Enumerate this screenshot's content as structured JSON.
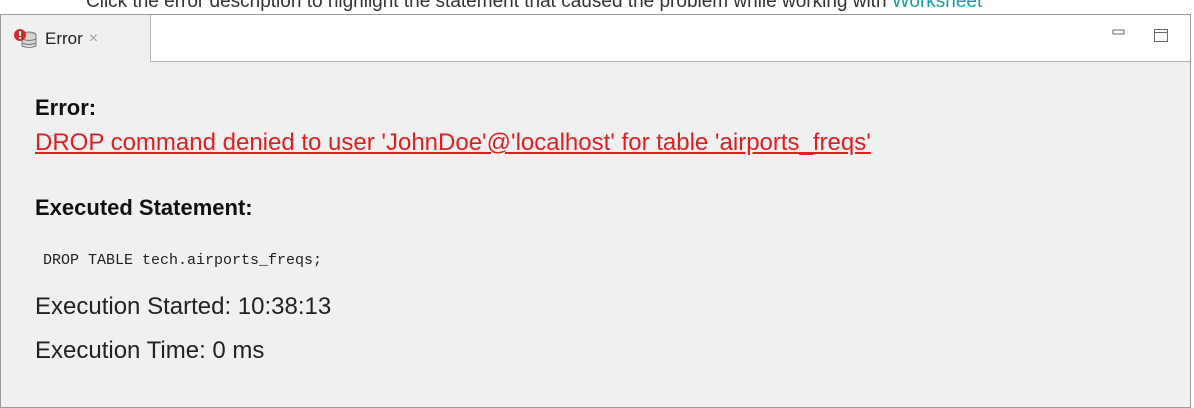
{
  "instruction": {
    "text": "Click the error description to highlight the statement that caused the problem while working with ",
    "link": "Worksheet"
  },
  "tab": {
    "label": "Error",
    "close": "×"
  },
  "error": {
    "heading": "Error:",
    "message": "DROP command denied to user 'JohnDoe'@'localhost' for table 'airports_freqs'"
  },
  "statement": {
    "heading": "Executed Statement:",
    "code": "DROP TABLE tech.airports_freqs;"
  },
  "execution": {
    "started": "Execution Started: 10:38:13",
    "time": "Execution Time: 0 ms"
  },
  "colors": {
    "error_text": "#e02020",
    "link": "#1a9e9e",
    "panel_bg": "#f0f0f0"
  },
  "icons": {
    "tab": "database-error-icon",
    "minimize": "minimize-icon",
    "maximize": "maximize-icon"
  }
}
